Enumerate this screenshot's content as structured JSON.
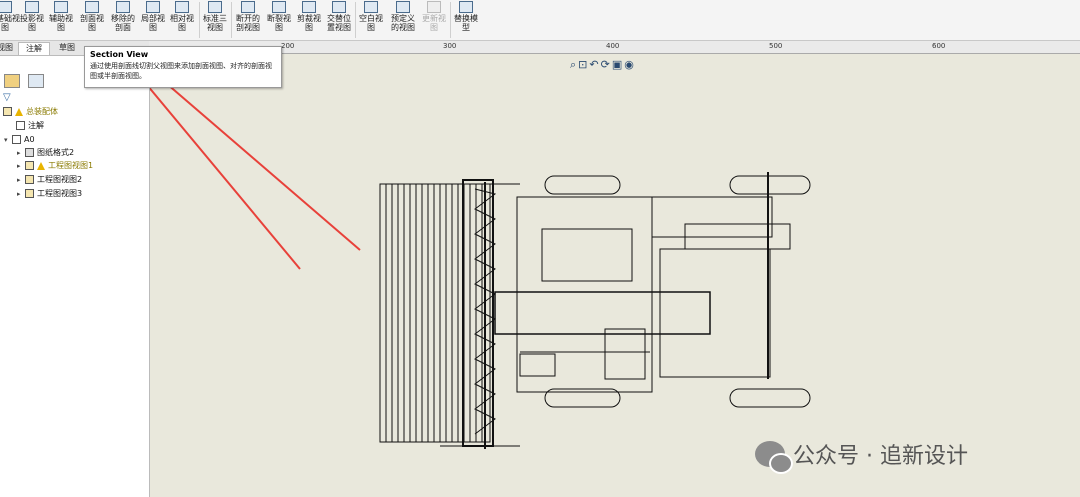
{
  "toolbar": {
    "buttons": [
      {
        "label": "基础视\n图",
        "disabled": false
      },
      {
        "label": "投影视\n图",
        "disabled": false
      },
      {
        "label": "辅助视\n图",
        "disabled": false
      },
      {
        "label": "剖面视\n图",
        "disabled": false
      },
      {
        "label": "移除的\n剖面",
        "disabled": false
      },
      {
        "label": "局部视\n图",
        "disabled": false
      },
      {
        "label": "相对视\n图",
        "disabled": false
      },
      {
        "label": "标准三\n视图",
        "disabled": false
      },
      {
        "label": "断开的\n剖视图",
        "disabled": false
      },
      {
        "label": "断裂视\n图",
        "disabled": false
      },
      {
        "label": "剪裁视\n图",
        "disabled": false
      },
      {
        "label": "交替位\n置视图",
        "disabled": false
      },
      {
        "label": "空白视\n图",
        "disabled": false
      },
      {
        "label": "预定义\n的视图",
        "disabled": false
      },
      {
        "label": "更新视\n图",
        "disabled": true
      },
      {
        "label": "替换模\n型",
        "disabled": false
      }
    ]
  },
  "tabs": [
    "视图",
    "注解",
    "草图"
  ],
  "ruler": {
    "ticks": [
      "200",
      "300",
      "400",
      "500",
      "600"
    ]
  },
  "tooltip": {
    "title": "Section View",
    "description": "通过使用剖面线切割父视图来添加剖面视图、对齐的剖面视图或半剖面视图。"
  },
  "tree": {
    "root": "总装配体",
    "items": [
      "注解",
      "A0",
      "图纸格式2",
      "工程图视图1",
      "工程图视图2",
      "工程图视图3"
    ]
  },
  "watermark": {
    "text": "公众号 · 追新设计"
  },
  "colors": {
    "arrow": "#e8413a",
    "drawing": "#111111",
    "canvas": "#e9e8dc"
  }
}
